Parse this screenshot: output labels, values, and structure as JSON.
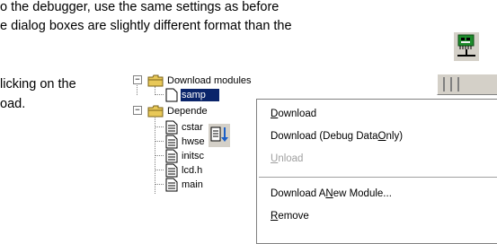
{
  "document": {
    "lines": [
      "o the debugger, use the same settings as before",
      "e dialog boxes are slightly different format than the",
      "licking on the",
      "oad."
    ]
  },
  "icons": {
    "board_icon": "board-download-icon",
    "doc_download_icon": "document-download-icon"
  },
  "tree": {
    "download_modules": "Download modules",
    "selected_module": "samp",
    "dependencies": "Depende",
    "files": [
      "cstar",
      "hwse",
      "initsc",
      "lcd.h",
      "main"
    ]
  },
  "context_menu": {
    "items": [
      {
        "label_pre": "",
        "mnemonic": "D",
        "label_post": "ownload",
        "enabled": true
      },
      {
        "label_pre": "Download (Debug Data ",
        "mnemonic": "O",
        "label_post": "nly)",
        "enabled": true
      },
      {
        "label_pre": "",
        "mnemonic": "U",
        "label_post": "nload",
        "enabled": false
      },
      {
        "label_pre": "Download A ",
        "mnemonic": "N",
        "label_post": "ew Module...",
        "enabled": true
      },
      {
        "label_pre": "",
        "mnemonic": "R",
        "label_post": "emove",
        "enabled": true
      }
    ]
  },
  "colors": {
    "selection": "#0a246a",
    "folder": "#e8c858",
    "icon_green": "#1e8c2c"
  }
}
